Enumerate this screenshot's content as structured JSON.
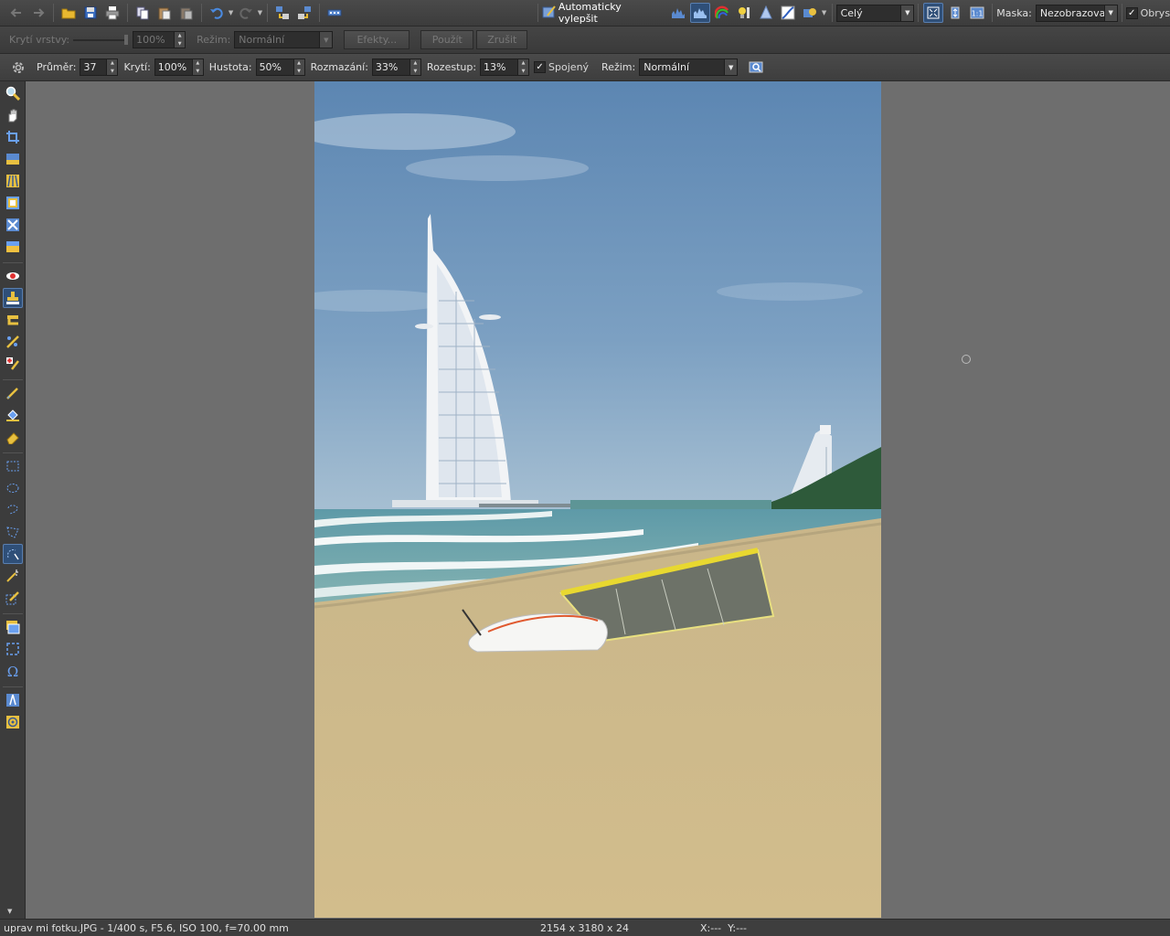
{
  "toolbar1": {
    "auto_enhance_label": "Automaticky vylepšit",
    "zoom_select": "Celý",
    "mask_label": "Maska:",
    "mask_select": "Nezobrazovat",
    "outline_label": "Obrys",
    "outline_checked": true
  },
  "toolbar2": {
    "layer_opacity_label": "Krytí vrstvy:",
    "layer_opacity_value": "100%",
    "mode_label": "Režim:",
    "mode_value": "Normální",
    "effects_button": "Efekty...",
    "apply_button": "Použít",
    "cancel_button": "Zrušit"
  },
  "toolbar3": {
    "diameter_label": "Průměr:",
    "diameter_value": "37",
    "opacity_label": "Krytí:",
    "opacity_value": "100%",
    "density_label": "Hustota:",
    "density_value": "50%",
    "blur_label": "Rozmazání:",
    "blur_value": "33%",
    "spacing_label": "Rozestup:",
    "spacing_value": "13%",
    "continuous_label": "Spojený",
    "continuous_checked": true,
    "mode_label": "Režim:",
    "mode_value": "Normální"
  },
  "status": {
    "file_info": "uprav mi fotku.JPG - 1/400 s, F5.6, ISO 100, f=70.00 mm",
    "dimensions": "2154 x 3180 x 24",
    "coords": "X:---  Y:---"
  },
  "colors": {
    "accent": "#2f4f78",
    "panel": "#3c3c3c",
    "canvas_bg": "#6e6e6e"
  }
}
